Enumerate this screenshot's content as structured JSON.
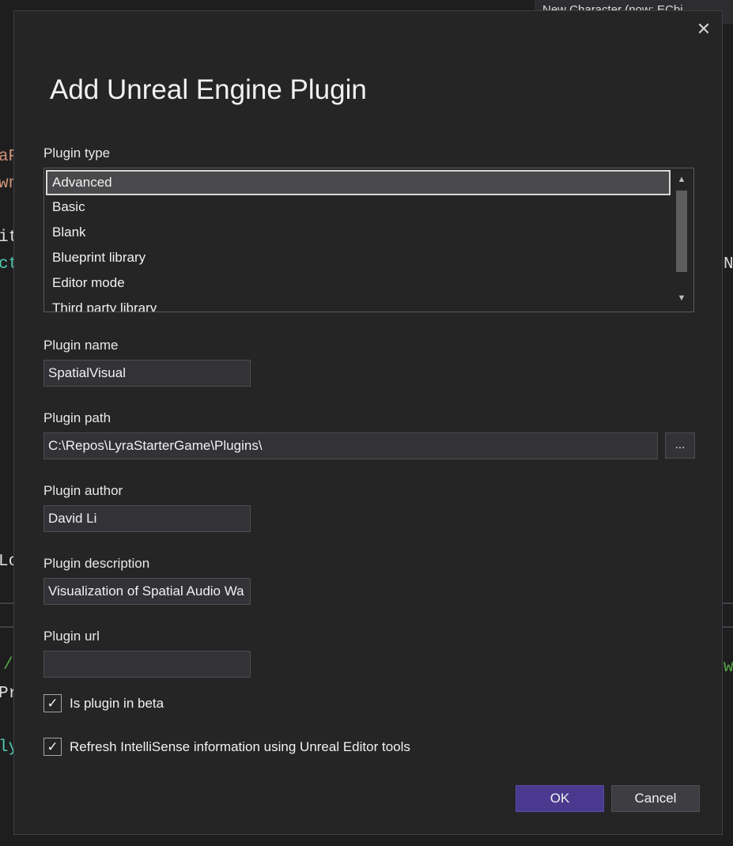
{
  "background": {
    "tab_label": "New Character (now: ECbi",
    "fragments": [
      {
        "text": "aP",
        "color": "#ce9178"
      },
      {
        "text": "wn",
        "color": "#ce9178"
      },
      {
        "text": "it",
        "color": "#dcdcdc"
      },
      {
        "text": "ct",
        "color": "#4ec9b0"
      },
      {
        "text": "N",
        "color": "#dcdcdc"
      },
      {
        "text": "Lo",
        "color": "#dcdcdc"
      },
      {
        "text": "/",
        "color": "#57a64a"
      },
      {
        "text": "w",
        "color": "#57a64a"
      },
      {
        "text": "Pr",
        "color": "#dcdcdc"
      },
      {
        "text": "ly",
        "color": "#4ec9b0"
      }
    ]
  },
  "dialog": {
    "title": "Add Unreal Engine Plugin",
    "close_icon": "close-icon",
    "plugin_type": {
      "label": "Plugin type",
      "options": [
        "Advanced",
        "Basic",
        "Blank",
        "Blueprint library",
        "Editor mode",
        "Third party library"
      ],
      "selected": "Advanced"
    },
    "plugin_name": {
      "label": "Plugin name",
      "value": "SpatialVisual"
    },
    "plugin_path": {
      "label": "Plugin path",
      "value": "C:\\Repos\\LyraStarterGame\\Plugins\\",
      "browse_label": "..."
    },
    "plugin_author": {
      "label": "Plugin author",
      "value": "David Li"
    },
    "plugin_description": {
      "label": "Plugin description",
      "value": "Visualization of Spatial Audio Wa"
    },
    "plugin_url": {
      "label": "Plugin url",
      "value": ""
    },
    "is_beta": {
      "label": "Is plugin in beta",
      "checked": true
    },
    "refresh_intellisense": {
      "label": "Refresh IntelliSense information using Unreal Editor tools",
      "checked": true
    },
    "ok_label": "OK",
    "cancel_label": "Cancel"
  },
  "colors": {
    "accent": "#4a3a8f",
    "dialog_bg": "#252526",
    "field_bg": "#333337"
  }
}
